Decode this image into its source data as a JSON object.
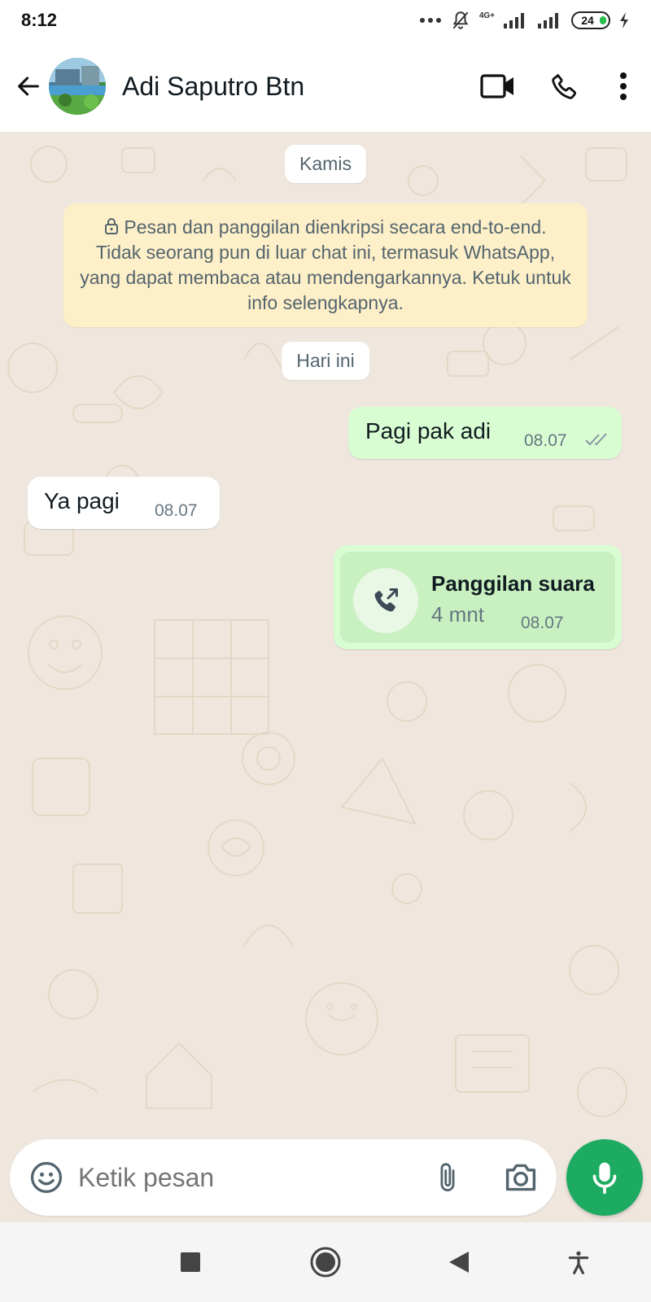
{
  "status_bar": {
    "time": "8:12",
    "network_label": "4G+",
    "battery": "24"
  },
  "header": {
    "contact_name": "Adi Saputro Btn",
    "icons": [
      "back-arrow-icon",
      "video-call-icon",
      "voice-call-icon",
      "more-vertical-icon"
    ]
  },
  "chat": {
    "date_chips": [
      "Kamis",
      "Hari ini"
    ],
    "encryption_notice": "Pesan dan panggilan dienkripsi secara end-to-end. Tidak seorang pun di luar chat ini, termasuk WhatsApp, yang dapat membaca atau mendengarkannya. Ketuk untuk info selengkapnya.",
    "messages": [
      {
        "direction": "out",
        "text": "Pagi pak adi",
        "time": "08.07",
        "status": "read"
      },
      {
        "direction": "in",
        "text": "Ya pagi",
        "time": "08.07"
      },
      {
        "direction": "out",
        "type": "call",
        "title": "Panggilan suara",
        "duration": "4 mnt",
        "time": "08.07"
      }
    ]
  },
  "composer": {
    "placeholder": "Ketik pesan",
    "icons": [
      "emoji-icon",
      "attach-icon",
      "camera-icon",
      "mic-icon"
    ]
  },
  "colors": {
    "outgoing_bubble": "#d9fdd3",
    "incoming_bubble": "#ffffff",
    "encryption_bg": "#fdefc7",
    "chat_bg": "#efe7de",
    "accent": "#1daa61"
  }
}
